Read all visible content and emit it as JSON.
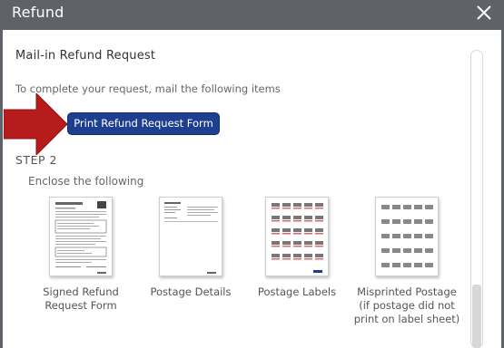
{
  "dialog": {
    "title": "Refund",
    "close_icon": "close-icon"
  },
  "content": {
    "heading": "Mail-in Refund Request",
    "instructions": "To complete your request, mail the following items",
    "print_button": "Print Refund Request Form",
    "step_label": "STEP 2",
    "enclose_label": "Enclose the following",
    "items": [
      {
        "label": "Signed Refund Request Form",
        "icon": "refund-form-document-icon"
      },
      {
        "label": "Postage Details",
        "icon": "postage-details-document-icon"
      },
      {
        "label": "Postage Labels",
        "icon": "postage-labels-sheet-icon"
      },
      {
        "label": "Misprinted Postage (if postage did not print on label sheet)",
        "icon": "misprinted-postage-sheet-icon"
      }
    ]
  },
  "colors": {
    "titlebar": "#5f6369",
    "button": "#1e3f8f",
    "arrow": "#b71c1c"
  }
}
